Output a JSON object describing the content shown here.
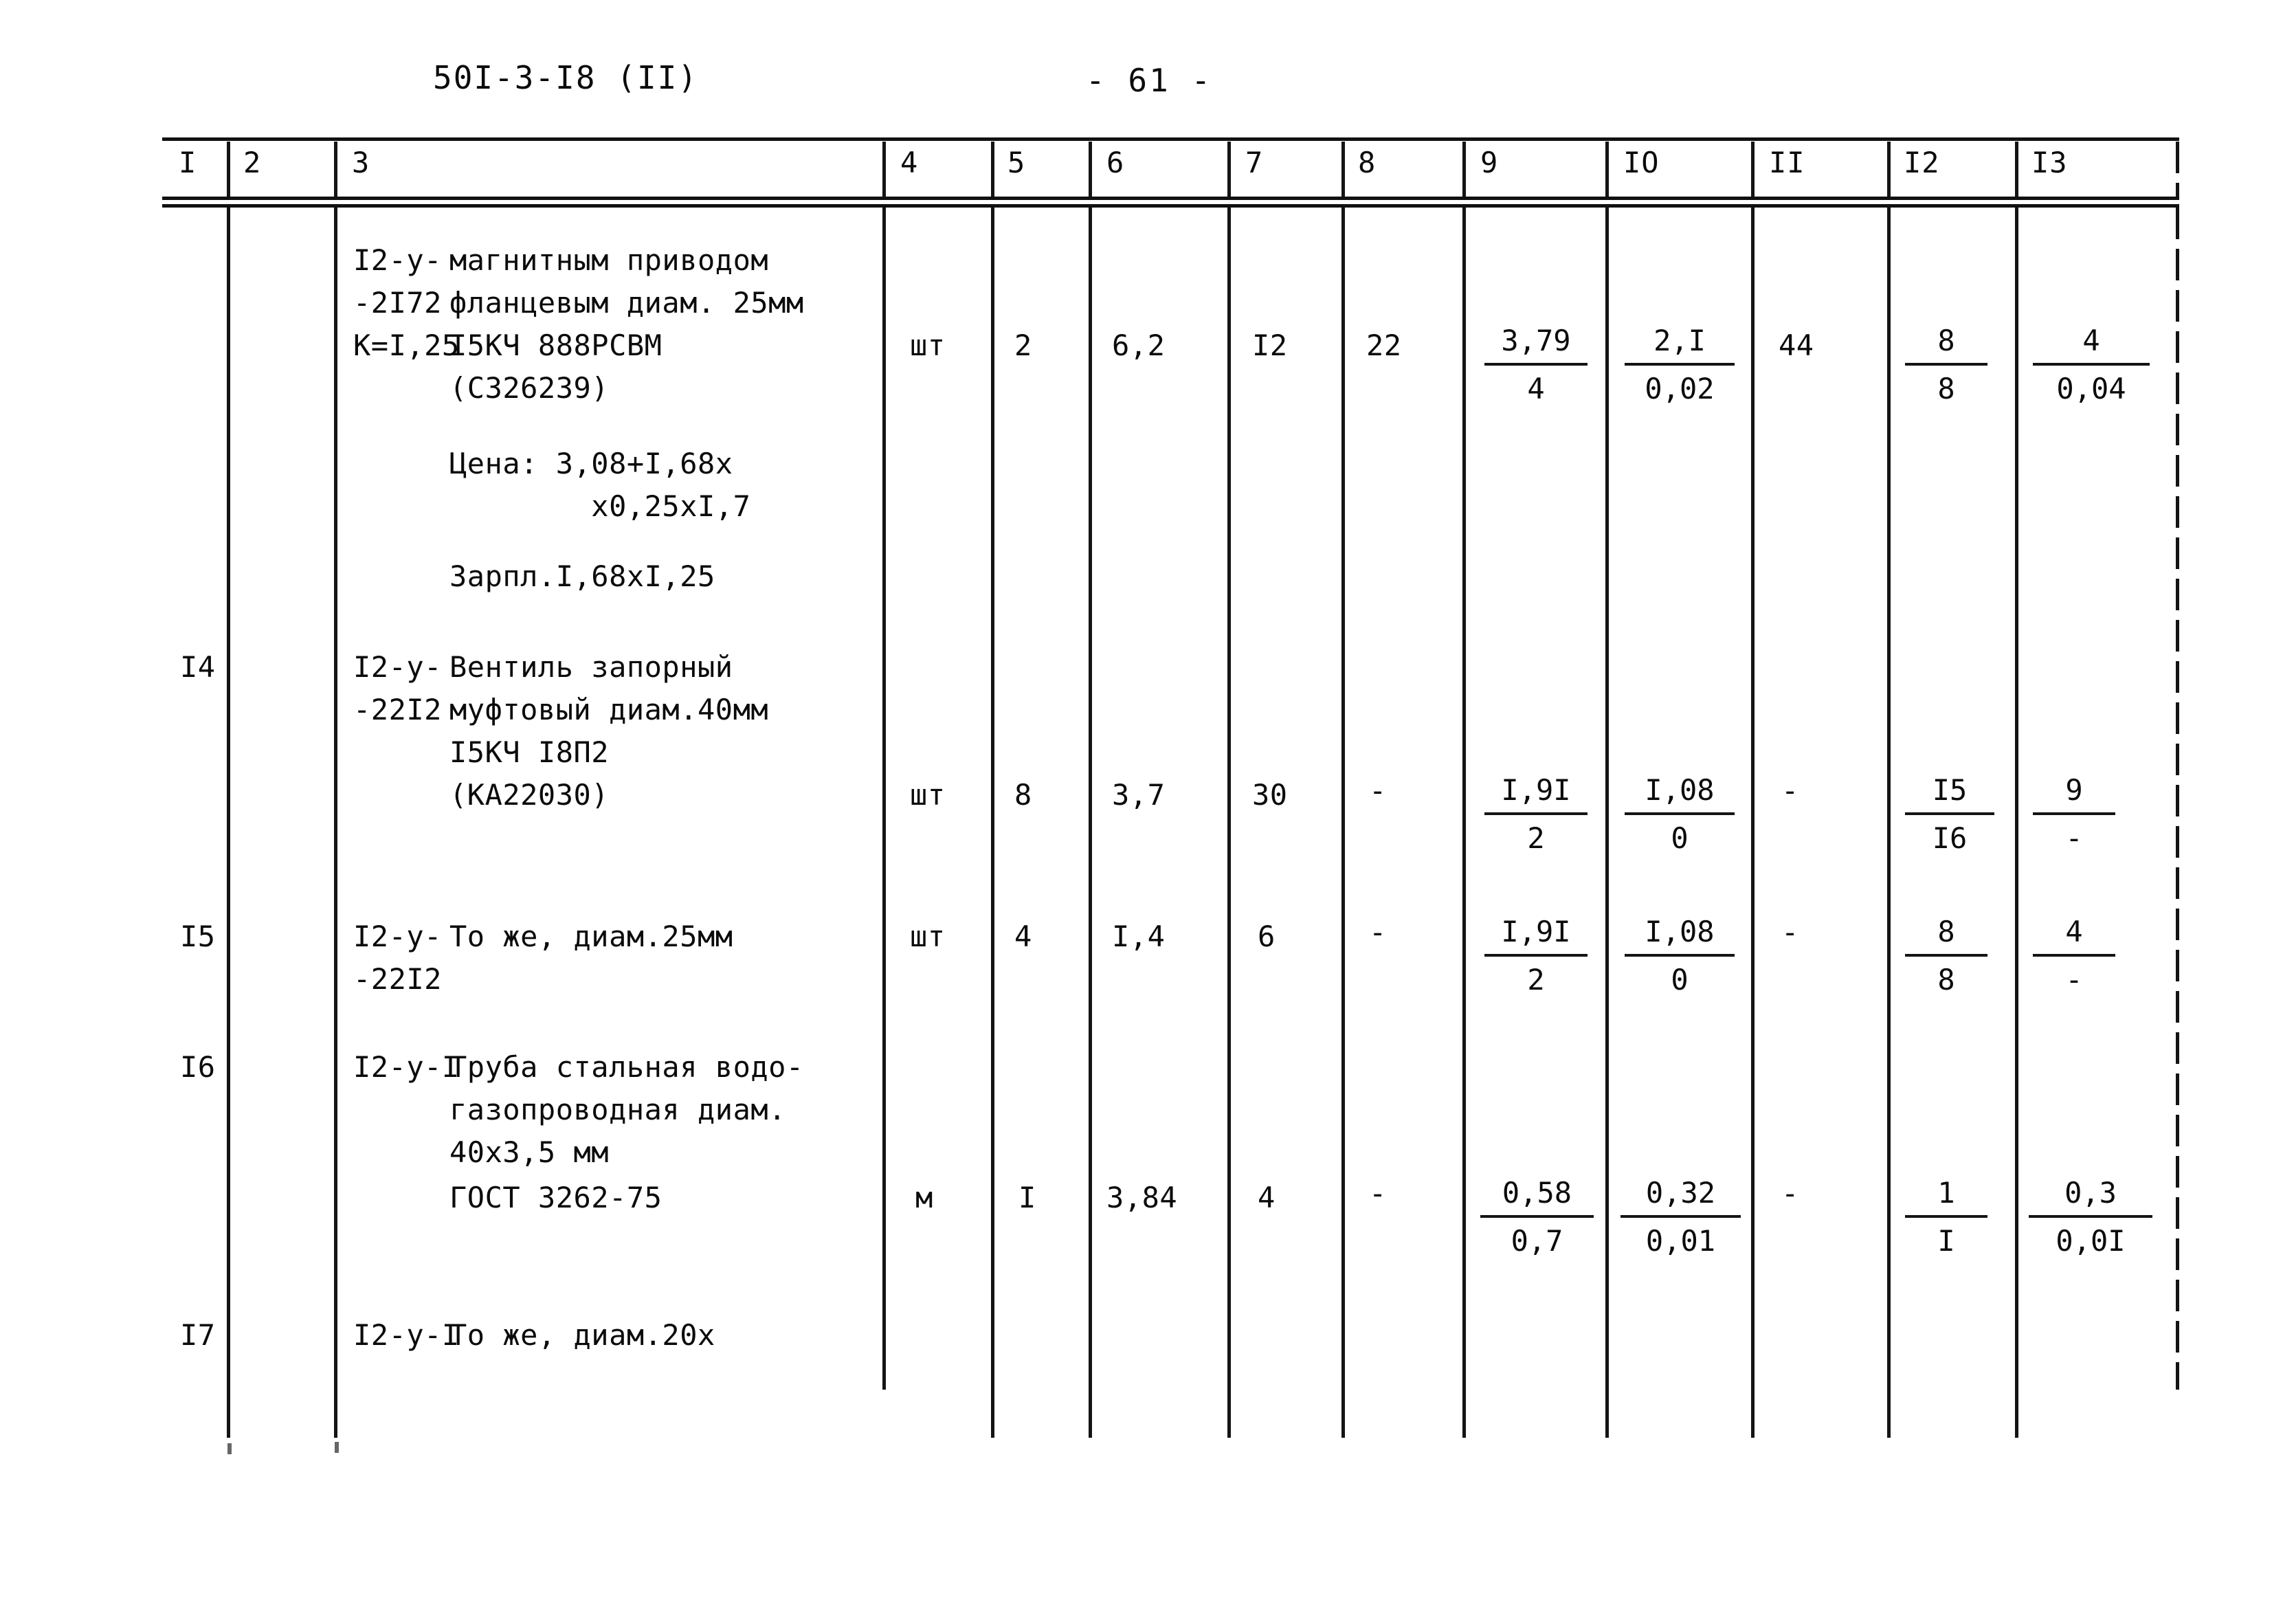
{
  "header": {
    "doc_code": "50I-3-I8 (II)",
    "page_number": "- 61 -"
  },
  "table": {
    "column_headers": [
      "I",
      "2",
      "3",
      "4",
      "5",
      "6",
      "7",
      "8",
      "9",
      "IO",
      "II",
      "I2",
      "I3"
    ],
    "rows": [
      {
        "num": "",
        "code_lines": [
          "I2-y-",
          "-2I72",
          "K=I,25"
        ],
        "desc_lines": [
          "магнитным приводом",
          "фланцевым диам. 25мм",
          "I5КЧ 888РСВМ",
          "(С326239)"
        ],
        "note_lines": [
          "Цена: 3,08+I,68х",
          "        х0,25хI,7",
          "Зарпл.I,68хI,25"
        ],
        "unit": "шт",
        "c5": "2",
        "c6": "6,2",
        "c7": "I2",
        "c8": "22",
        "c9_num": "3,79",
        "c9_den": "4",
        "c10_num": "2,I",
        "c10_den": "0,02",
        "c11": "44",
        "c12_num": "8",
        "c12_den": "8",
        "c13_num": "4",
        "c13_den": "0,04"
      },
      {
        "num": "I4",
        "code_lines": [
          "I2-y-",
          "-22I2"
        ],
        "desc_lines": [
          "Вентиль запорный",
          "муфтовый диам.40мм",
          "I5КЧ I8П2",
          "(КА22030)"
        ],
        "note_lines": [],
        "unit": "шт",
        "c5": "8",
        "c6": "3,7",
        "c7": "30",
        "c8": "-",
        "c9_num": "I,9I",
        "c9_den": "2",
        "c10_num": "I,08",
        "c10_den": "0",
        "c11": "-",
        "c12_num": "I5",
        "c12_den": "I6",
        "c13_num": "9",
        "c13_den": "-"
      },
      {
        "num": "I5",
        "code_lines": [
          "I2-y-",
          "-22I2"
        ],
        "desc_lines": [
          "То же, диам.25мм"
        ],
        "note_lines": [],
        "unit": "шт",
        "c5": "4",
        "c6": "I,4",
        "c7": "6",
        "c8": "-",
        "c9_num": "I,9I",
        "c9_den": "2",
        "c10_num": "I,08",
        "c10_den": "0",
        "c11": "-",
        "c12_num": "8",
        "c12_den": "8",
        "c13_num": "4",
        "c13_den": "-"
      },
      {
        "num": "I6",
        "code_lines": [
          "I2-y-I"
        ],
        "desc_lines": [
          "Труба стальная водо-",
          "газопроводная диам.",
          "40х3,5 мм",
          "ГОСТ 3262-75"
        ],
        "note_lines": [],
        "unit": "м",
        "c5": "I",
        "c6": "3,84",
        "c7": "4",
        "c8": "-",
        "c9_num": "0,58",
        "c9_den": "0,7",
        "c10_num": "0,32",
        "c10_den": "0,01",
        "c11": "-",
        "c12_num": "1",
        "c12_den": "I",
        "c13_num": "0,3",
        "c13_den": "0,0I"
      },
      {
        "num": "I7",
        "code_lines": [
          "I2-y-I"
        ],
        "desc_lines": [
          "То же, диам.20х"
        ],
        "note_lines": [],
        "unit": "",
        "c5": "",
        "c6": "",
        "c7": "",
        "c8": "",
        "c9_num": "",
        "c9_den": "",
        "c10_num": "",
        "c10_den": "",
        "c11": "",
        "c12_num": "",
        "c12_den": "",
        "c13_num": "",
        "c13_den": ""
      }
    ]
  }
}
